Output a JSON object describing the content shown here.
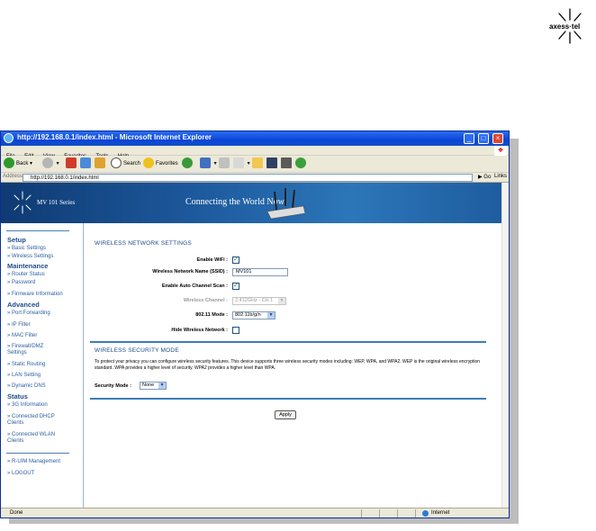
{
  "logo": {
    "text": "axess·tel"
  },
  "window": {
    "title": "http://192.168.0.1/index.html - Microsoft Internet Explorer",
    "minimize": "_",
    "maximize": "□",
    "close": "×"
  },
  "menu": [
    "File",
    "Edit",
    "View",
    "Favorites",
    "Tools",
    "Help"
  ],
  "toolbar": {
    "back": "Back",
    "search": "Search",
    "favorites": "Favorites"
  },
  "address": {
    "label": "Address",
    "url": "http://192.168.0.1/index.html",
    "go": "Go",
    "links": "Links"
  },
  "banner": {
    "series": "MV 101 Series",
    "slogan": "Connecting the World Now"
  },
  "sidebar": {
    "sections": [
      {
        "head": "Setup",
        "links": [
          "» Basic Settings",
          "» Wireless Settings"
        ]
      },
      {
        "head": "Maintenance",
        "links": [
          "» Router Status",
          "» Password",
          "» Firmware Information"
        ]
      },
      {
        "head": "Advanced",
        "links": [
          "» Port Forwarding",
          "» IP Filter",
          "» MAC Filter",
          "» Firewall/DMZ Settings",
          "» Static Routing",
          "» LAN Setting",
          "» Dynamic DNS"
        ]
      },
      {
        "head": "Status",
        "links": [
          "» 3G Information",
          "» Connected DHCP Clients",
          "» Connected WLAN Clients"
        ]
      }
    ],
    "bottom_links": [
      "» R-UIM Management",
      "» LOGOUT"
    ]
  },
  "wireless": {
    "title": "WIRELESS NETWORK SETTINGS",
    "enable_wifi_label": "Enable WiFi :",
    "enable_wifi": true,
    "ssid_label": "Wireless Network Name (SSID) :",
    "ssid_value": "MV101",
    "auto_channel_label": "Enable Auto Channel Scan :",
    "auto_channel": true,
    "channel_label": "Wireless Channel :",
    "channel_value": "2.412GHz - CH 1",
    "mode_label": "802.11 Mode :",
    "mode_value": "802.11b/g/n",
    "hide_label": "Hide Wireless Network :",
    "hide": false
  },
  "security": {
    "title": "WIRELESS SECURITY MODE",
    "description": "To protect your privacy you can configure wireless security features. This device supports three wireless security modes including: WEP, WPA, and WPA2. WEP is the original wireless encryption standard. WPA provides a higher level of security. WPA2 provides a higher level than WPA.",
    "mode_label": "Security Mode :",
    "mode_value": "None"
  },
  "apply_label": "Apply",
  "status": {
    "text": "Done",
    "zone": "Internet"
  },
  "colors": {
    "accent": "#1c4c8c",
    "banner": "#1d5a9e",
    "titlebar": "#0a44d8"
  }
}
